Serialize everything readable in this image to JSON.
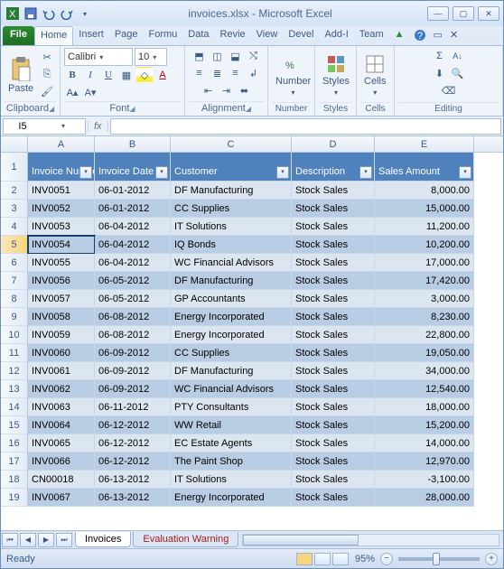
{
  "title": "invoices.xlsx - Microsoft Excel",
  "qat": {
    "save": "Save",
    "undo": "Undo",
    "redo": "Redo",
    "more": "More"
  },
  "tabs": [
    "File",
    "Home",
    "Insert",
    "Page",
    "Formu",
    "Data",
    "Revie",
    "View",
    "Devel",
    "Add-I",
    "Team"
  ],
  "ribbon": {
    "clipboard": {
      "label": "Clipboard",
      "paste": "Paste"
    },
    "font": {
      "label": "Font",
      "family": "Calibri",
      "size": "10",
      "bold": "B",
      "italic": "I",
      "underline": "U"
    },
    "alignment": {
      "label": "Alignment"
    },
    "number": {
      "label": "Number",
      "btn": "Number"
    },
    "styles": {
      "label": "Styles",
      "btn": "Styles"
    },
    "cells": {
      "label": "Cells",
      "btn": "Cells"
    },
    "editing": {
      "label": "Editing"
    }
  },
  "namebox": "I5",
  "fx": "fx",
  "columns": [
    "A",
    "B",
    "C",
    "D",
    "E"
  ],
  "headers": [
    "Invoice Number",
    "Invoice Date",
    "Customer",
    "Description",
    "Sales Amount"
  ],
  "rows": [
    {
      "n": 2,
      "inv": "INV0051",
      "date": "06-01-2012",
      "cust": "DF Manufacturing",
      "desc": "Stock Sales",
      "amt": "8,000.00"
    },
    {
      "n": 3,
      "inv": "INV0052",
      "date": "06-01-2012",
      "cust": "CC Supplies",
      "desc": "Stock Sales",
      "amt": "15,000.00"
    },
    {
      "n": 4,
      "inv": "INV0053",
      "date": "06-04-2012",
      "cust": "IT Solutions",
      "desc": "Stock Sales",
      "amt": "11,200.00"
    },
    {
      "n": 5,
      "inv": "INV0054",
      "date": "06-04-2012",
      "cust": "IQ Bonds",
      "desc": "Stock Sales",
      "amt": "10,200.00"
    },
    {
      "n": 6,
      "inv": "INV0055",
      "date": "06-04-2012",
      "cust": "WC Financial Advisors",
      "desc": "Stock Sales",
      "amt": "17,000.00"
    },
    {
      "n": 7,
      "inv": "INV0056",
      "date": "06-05-2012",
      "cust": "DF Manufacturing",
      "desc": "Stock Sales",
      "amt": "17,420.00"
    },
    {
      "n": 8,
      "inv": "INV0057",
      "date": "06-05-2012",
      "cust": "GP Accountants",
      "desc": "Stock Sales",
      "amt": "3,000.00"
    },
    {
      "n": 9,
      "inv": "INV0058",
      "date": "06-08-2012",
      "cust": "Energy Incorporated",
      "desc": "Stock Sales",
      "amt": "8,230.00"
    },
    {
      "n": 10,
      "inv": "INV0059",
      "date": "06-08-2012",
      "cust": "Energy Incorporated",
      "desc": "Stock Sales",
      "amt": "22,800.00"
    },
    {
      "n": 11,
      "inv": "INV0060",
      "date": "06-09-2012",
      "cust": "CC Supplies",
      "desc": "Stock Sales",
      "amt": "19,050.00"
    },
    {
      "n": 12,
      "inv": "INV0061",
      "date": "06-09-2012",
      "cust": "DF Manufacturing",
      "desc": "Stock Sales",
      "amt": "34,000.00"
    },
    {
      "n": 13,
      "inv": "INV0062",
      "date": "06-09-2012",
      "cust": "WC Financial Advisors",
      "desc": "Stock Sales",
      "amt": "12,540.00"
    },
    {
      "n": 14,
      "inv": "INV0063",
      "date": "06-11-2012",
      "cust": "PTY Consultants",
      "desc": "Stock Sales",
      "amt": "18,000.00"
    },
    {
      "n": 15,
      "inv": "INV0064",
      "date": "06-12-2012",
      "cust": "WW Retail",
      "desc": "Stock Sales",
      "amt": "15,200.00"
    },
    {
      "n": 16,
      "inv": "INV0065",
      "date": "06-12-2012",
      "cust": "EC Estate Agents",
      "desc": "Stock Sales",
      "amt": "14,000.00"
    },
    {
      "n": 17,
      "inv": "INV0066",
      "date": "06-12-2012",
      "cust": "The Paint Shop",
      "desc": "Stock Sales",
      "amt": "12,970.00"
    },
    {
      "n": 18,
      "inv": "CN00018",
      "date": "06-13-2012",
      "cust": "IT Solutions",
      "desc": "Stock Sales",
      "amt": "-3,100.00"
    },
    {
      "n": 19,
      "inv": "INV0067",
      "date": "06-13-2012",
      "cust": "Energy Incorporated",
      "desc": "Stock Sales",
      "amt": "28,000.00"
    }
  ],
  "selected_row": 5,
  "sheets": [
    "Invoices",
    "Evaluation Warning"
  ],
  "status": {
    "ready": "Ready",
    "zoom": "95%"
  }
}
